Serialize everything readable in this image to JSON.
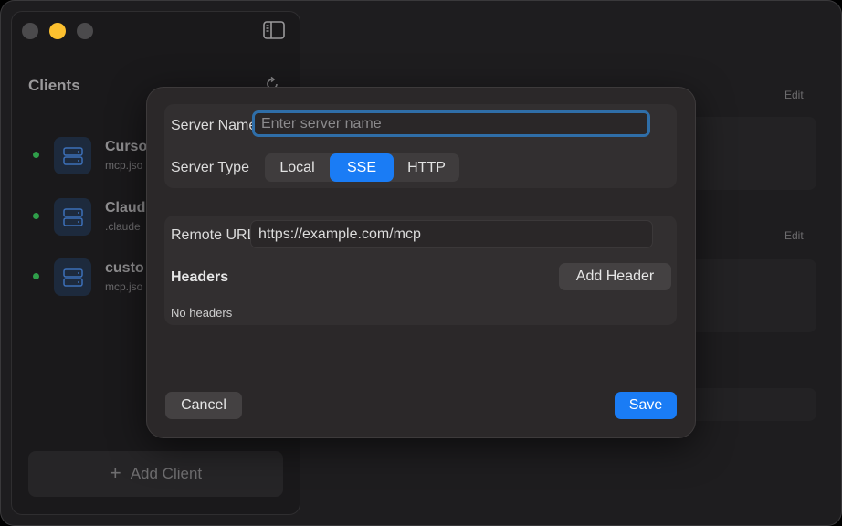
{
  "sidebar": {
    "title": "Clients",
    "clients": [
      {
        "name": "Curso",
        "path": "mcp.jso",
        "status": "connected"
      },
      {
        "name": "Claud",
        "path": ".claude",
        "status": "connected"
      },
      {
        "name": "custo",
        "path": "mcp.jso",
        "status": "connected"
      }
    ],
    "add_client_label": "Add Client",
    "add_client_icon": "plus-icon"
  },
  "main": {
    "edit_label_1": "Edit",
    "edit_label_2": "Edit"
  },
  "modal": {
    "server_name_label": "Server Name",
    "server_name_placeholder": "Enter server name",
    "server_name_value": "",
    "server_type_label": "Server Type",
    "server_types": [
      "Local",
      "SSE",
      "HTTP"
    ],
    "server_type_selected": "SSE",
    "remote_url_label": "Remote URL",
    "remote_url_value": "https://example.com/mcp",
    "headers_title": "Headers",
    "add_header_label": "Add Header",
    "no_headers_label": "No headers",
    "cancel_label": "Cancel",
    "save_label": "Save"
  },
  "colors": {
    "accent": "#1a7cf5",
    "status_green": "#2f9e4a",
    "traffic_yellow": "#fcc02f"
  }
}
